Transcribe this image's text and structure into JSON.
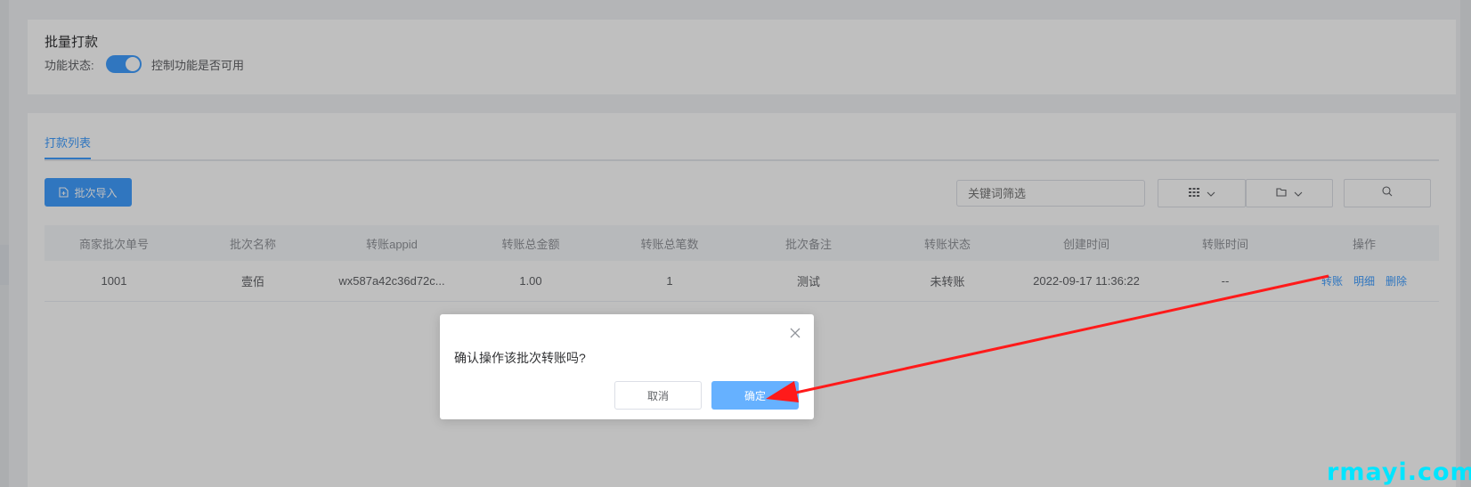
{
  "feature_card": {
    "title": "批量打款",
    "status_label": "功能状态:",
    "switch_on": true,
    "switch_desc": "控制功能是否可用"
  },
  "list": {
    "tab_label": "打款列表",
    "import_button": "批次导入",
    "search_placeholder": "关键词筛选",
    "columns": [
      "商家批次单号",
      "批次名称",
      "转账appid",
      "转账总金额",
      "转账总笔数",
      "批次备注",
      "转账状态",
      "创建时间",
      "转账时间",
      "操作"
    ],
    "rows": [
      {
        "batch_no": "1001",
        "batch_name": "壹佰",
        "appid": "wx587a42c36d72c...",
        "total_amount": "1.00",
        "total_count": "1",
        "remark": "测试",
        "status": "未转账",
        "created_at": "2022-09-17 11:36:22",
        "transfer_time": "--",
        "actions": [
          "转账",
          "明细",
          "删除"
        ]
      }
    ]
  },
  "dialog": {
    "message": "确认操作该批次转账吗?",
    "cancel_label": "取消",
    "ok_label": "确定"
  },
  "watermark": "rmayi.com",
  "colors": {
    "primary": "#409eff",
    "primary_light": "#66b1ff",
    "arrow": "#ff1a1a",
    "watermark": "#00e5ff"
  }
}
